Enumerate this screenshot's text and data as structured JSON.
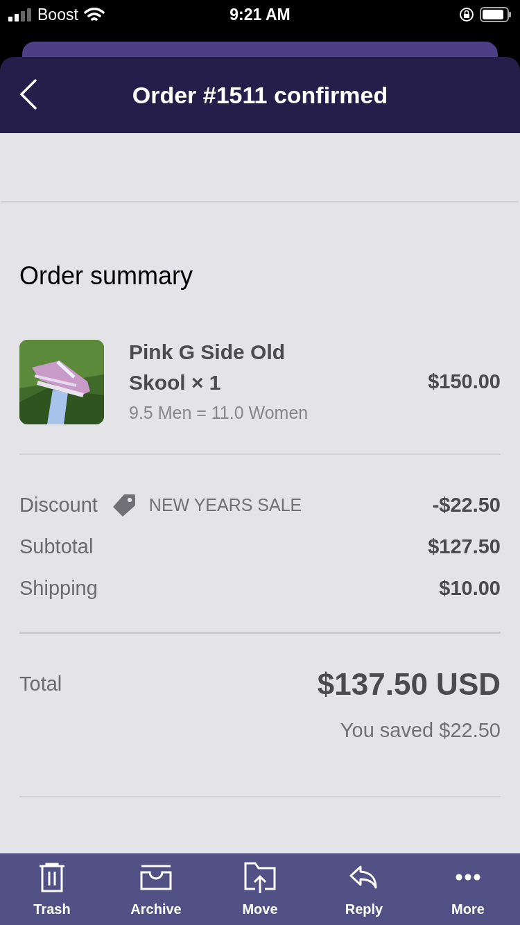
{
  "status_bar": {
    "carrier": "Boost",
    "time": "9:21 AM"
  },
  "header": {
    "title": "Order #1511 confirmed"
  },
  "order_summary": {
    "title": "Order summary",
    "items": [
      {
        "kind": "picture",
        "name": "Pink G Side Old Skool × 1",
        "variant": "9.5 Men = 11.0 Women",
        "price": "$150.00"
      }
    ],
    "lines": [
      {
        "label": "Discount",
        "code": "NEW YEARS SALE",
        "amount": "-$22.50"
      },
      {
        "label": "Subtotal",
        "amount": "$127.50"
      },
      {
        "label": "Shipping",
        "amount": "$10.00"
      }
    ],
    "total": {
      "label": "Total",
      "amount": "$137.50 USD",
      "saved": "You saved $22.50"
    }
  },
  "toolbar": [
    {
      "kind": "trash",
      "label": "Trash"
    },
    {
      "kind": "archive",
      "label": "Archive"
    },
    {
      "kind": "move",
      "label": "Move"
    },
    {
      "kind": "reply",
      "label": "Reply"
    },
    {
      "kind": "more",
      "label": "More"
    }
  ]
}
